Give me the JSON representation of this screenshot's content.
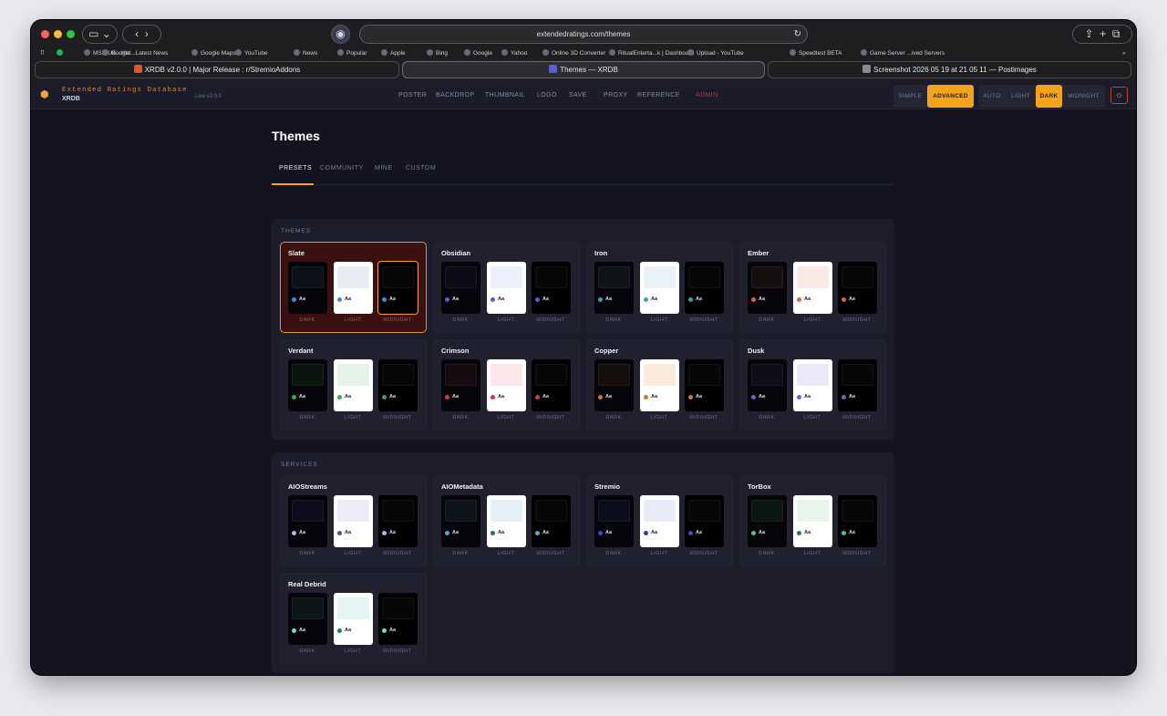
{
  "browser": {
    "url": "extendedratings.com/themes",
    "favorites": [
      "MSN UK - Hot...Latest News",
      "Google",
      "Google Maps",
      "YouTube",
      "News",
      "Popular",
      "Apple",
      "Bing",
      "Google",
      "Yahoo",
      "Online 3D Converter",
      "RitualEnterta...k | Dashboard",
      "Upload - YouTube",
      "Speedtest BETA",
      "Game Server ...ived Servers"
    ],
    "tabs": [
      "XRDB v2.0.0 | Major Release : r/StremioAddons",
      "Themes — XRDB",
      "Screenshot 2026 05 19 at 21 05 11 — Postimages"
    ]
  },
  "app": {
    "brand_title": "Extended Ratings Database",
    "brand_sub": "XRDB",
    "version": "Live v2.0.0",
    "nav": [
      "POSTER",
      "BACKDROP",
      "THUMBNAIL",
      "LOGO",
      "SAVE",
      "PROXY",
      "REFERENCE",
      "ADMIN"
    ],
    "mode": [
      "SIMPLE",
      "ADVANCED"
    ],
    "appearance": [
      "AUTO",
      "LIGHT",
      "DARK",
      "MIDNIGHT"
    ],
    "accent": "#f5a31a"
  },
  "page": {
    "title": "Themes",
    "subtabs": [
      "PRESETS",
      "COMMUNITY",
      "MINE",
      "CUSTOM"
    ],
    "swatch_labels": [
      "DARK",
      "LIGHT",
      "MIDNIGHT"
    ],
    "sample_text": "Aa"
  },
  "sections": [
    {
      "title": "THEMES",
      "items": [
        {
          "name": "Slate",
          "accent": "#3d8fd6",
          "dark": "#0e1018",
          "light": "#e9edf3",
          "selected": true
        },
        {
          "name": "Obsidian",
          "accent": "#5b5bd6",
          "dark": "#0c0c18",
          "light": "#eceffa",
          "selected": false
        },
        {
          "name": "Iron",
          "accent": "#3aa3a6",
          "dark": "#0f1416",
          "light": "#e8f1f5",
          "selected": false
        },
        {
          "name": "Ember",
          "accent": "#e0603a",
          "dark": "#150f0e",
          "light": "#fbe9e6",
          "selected": false
        },
        {
          "name": "Verdant",
          "accent": "#2fa85a",
          "dark": "#0c140f",
          "light": "#e6f3e8",
          "selected": false
        },
        {
          "name": "Crimson",
          "accent": "#d23a4a",
          "dark": "#150c0f",
          "light": "#fbe6ea",
          "selected": false
        },
        {
          "name": "Copper",
          "accent": "#d2782e",
          "dark": "#140f0c",
          "light": "#f9eadc",
          "selected": false
        },
        {
          "name": "Dusk",
          "accent": "#7b5ac4",
          "dark": "#0f0d18",
          "light": "#ece8f8",
          "selected": false
        }
      ]
    },
    {
      "title": "SERVICES",
      "items": [
        {
          "name": "AIOStreams",
          "accent": "#b9b0e8",
          "accent_light": "#5a4a8a",
          "dark": "#0e0d1c",
          "light": "#ecebf8",
          "selected": false
        },
        {
          "name": "AIOMetadata",
          "accent": "#5aa6c8",
          "accent_light": "#1e6e6a",
          "dark": "#0c141a",
          "light": "#e6f0f7",
          "selected": false
        },
        {
          "name": "Stremio",
          "accent": "#3a4ec8",
          "accent_light": "#2a3ab0",
          "dark": "#0c0e1c",
          "light": "#e8ecf8",
          "selected": false
        },
        {
          "name": "TorBox",
          "accent": "#4cc48a",
          "accent_light": "#1e7a4a",
          "dark": "#0b1610",
          "light": "#e6f4ec",
          "selected": false
        },
        {
          "name": "Real Debrid",
          "accent": "#6fe0c8",
          "accent_light": "#1e7a6a",
          "dark": "#0c1618",
          "light": "#e4f4f2",
          "selected": false
        }
      ]
    }
  ]
}
